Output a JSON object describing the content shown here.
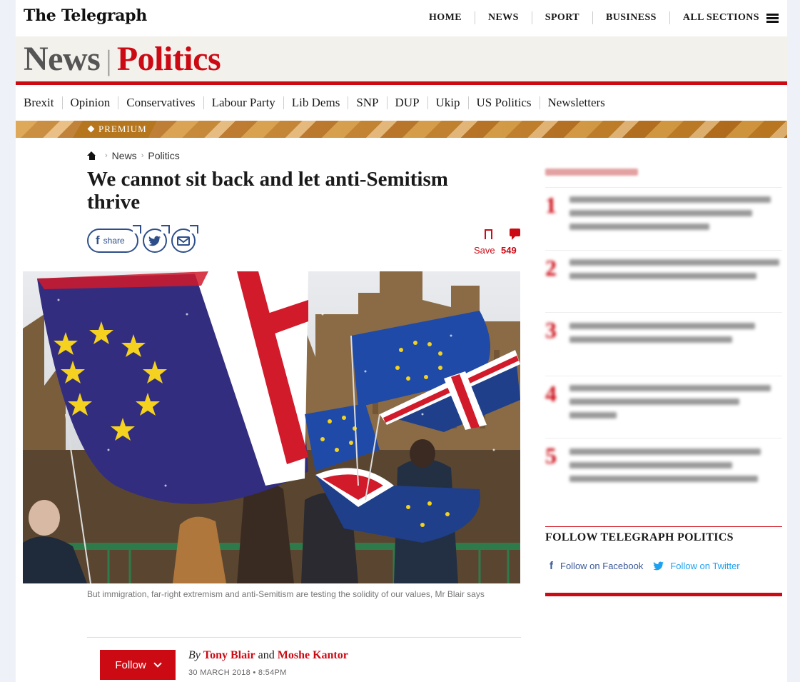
{
  "masthead": {
    "logo": "The Telegraph"
  },
  "top_nav": {
    "items": [
      "HOME",
      "NEWS",
      "SPORT",
      "BUSINESS",
      "ALL SECTIONS"
    ]
  },
  "section": {
    "parent": "News",
    "name": "Politics"
  },
  "sub_nav": {
    "items": [
      "Brexit",
      "Opinion",
      "Conservatives",
      "Labour Party",
      "Lib Dems",
      "SNP",
      "DUP",
      "Ukip",
      "US Politics",
      "Newsletters"
    ]
  },
  "premium": {
    "label": "PREMIUM"
  },
  "breadcrumb": {
    "items": [
      "News",
      "Politics"
    ]
  },
  "article": {
    "headline": "We cannot sit back and let anti-Semitism thrive",
    "share_label": "share",
    "save_label": "Save",
    "comment_count": "549",
    "caption": "But immigration, far-right extremism and anti-Semitism are testing the solidity of our values, Mr Blair says",
    "follow_label": "Follow",
    "byline": {
      "by": "By",
      "author1": "Tony Blair",
      "and": "and",
      "author2": "Moshe Kantor"
    },
    "date": "30 MARCH 2018 • 8:54PM"
  },
  "sidebar": {
    "more_stories": [
      {
        "num": "1"
      },
      {
        "num": "2"
      },
      {
        "num": "3"
      },
      {
        "num": "4"
      },
      {
        "num": "5"
      }
    ],
    "follow_heading": "FOLLOW TELEGRAPH POLITICS",
    "follow_facebook": "Follow on Facebook",
    "follow_twitter": "Follow on Twitter"
  },
  "colors": {
    "brand_red": "#cc0a14",
    "eu_blue": "#2a3a8c",
    "premium_gold": "#c8862a",
    "share_blue": "#2d4e8a"
  }
}
